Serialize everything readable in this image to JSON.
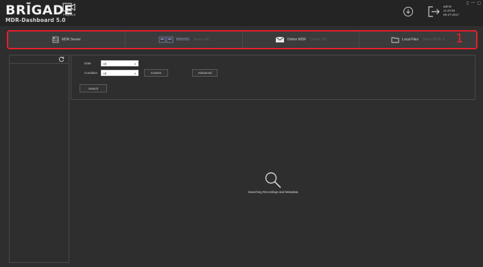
{
  "app": {
    "brand_name": "BRĪGADE",
    "brand_sub": "MDR-Dashboard 5.0",
    "playback_label": "Playback"
  },
  "user": {
    "name": "admin",
    "time": "11:43:56",
    "date": "08-27-2017"
  },
  "window_controls": [
    "▯",
    "—",
    "▢",
    "✕"
  ],
  "tabs": [
    {
      "label": "MDR Server",
      "sub": "",
      "icon": "server-icon"
    },
    {
      "label": "HDD/SD",
      "sub": "Search All",
      "icon": "hdd-sd-icon"
    },
    {
      "label": "Online MDR",
      "sub": "Online: 0/0",
      "icon": "online-mdr-icon"
    },
    {
      "label": "Local Files",
      "sub": "Select MDR: 0",
      "icon": "folder-icon"
    }
  ],
  "annotation": "1",
  "filter": {
    "date_label": "Date",
    "date_value": "All",
    "condition_label": "Condition",
    "condition_value": "All",
    "custom_label": "Custom",
    "advanced_label": "Advanced",
    "search_label": "Search"
  },
  "results": {
    "status_text": "Searching Recordings and Metadata"
  },
  "colors": {
    "accent_red": "#e8202a",
    "background": "#2e2e2e"
  }
}
